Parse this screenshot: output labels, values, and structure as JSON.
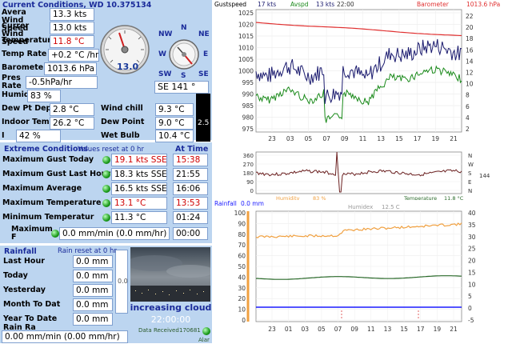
{
  "current": {
    "title": "Current Conditions, WD 10.375134",
    "rows": [
      {
        "label": "Avera Wind Speed",
        "value": "13.3 kts"
      },
      {
        "label": "Currer Wind Speed",
        "value": "13.0 kts"
      },
      {
        "label": "Temperature",
        "value": "11.8 °C"
      },
      {
        "label": "Temp Rate",
        "value": "+0.2 °C /hr"
      },
      {
        "label": "Barometer",
        "value": "1013.6 hPa"
      },
      {
        "label": "Pres Rate",
        "value": "-0.5hPa/hr"
      },
      {
        "label": "Humidit",
        "value": "83 %"
      },
      {
        "label": "Dew Pt Depr.",
        "value": "2.8 °C"
      },
      {
        "label": "Indoor Temp.",
        "value": "26.2 °C"
      },
      {
        "label": "I",
        "value": "42 %"
      }
    ],
    "dial_value": "13.0",
    "compass_labels": [
      "NW",
      "N",
      "NE",
      "W",
      "E",
      "SW",
      "S",
      "SE"
    ],
    "direction": "SE  141 °",
    "wind_chill_label": "Wind chill",
    "wind_chill": "9.3 °C",
    "dew_point_label": "Dew Point",
    "dew_point": "9.0 °C",
    "wet_bulb_label": "Wet Bulb",
    "wet_bulb": "10.4 °C",
    "side_value": "2.5"
  },
  "extreme": {
    "title": "Extreme Conditions",
    "subtitle": "Values reset at 0 hr",
    "at_time": "At Time",
    "rows": [
      {
        "label": "Maximum Gust Today",
        "value": "19.1 kts SSE",
        "time": "15:38",
        "red": true
      },
      {
        "label": "Maximum Gust Last Hour",
        "value": "18.3 kts SSE",
        "time": "21:55",
        "red": false
      },
      {
        "label": "Maximum Average",
        "value": "16.5 kts SSE",
        "time": "16:06",
        "red": false
      },
      {
        "label": "Maximum Temperature",
        "value": "13.1 °C",
        "time": "13:53",
        "red": true
      },
      {
        "label": "Minimum Temperatur",
        "value": "11.3 °C",
        "time": "01:24",
        "red": false
      },
      {
        "label": "Maximum F",
        "value": "0.0 mm/min (0.0 mm/hr)",
        "time": "00:00",
        "red": false
      }
    ]
  },
  "rain": {
    "title": "Rainfall",
    "subtitle": "Rain reset at 0 hr",
    "rows": [
      {
        "label": "Last Hour",
        "value": "0.0 mm"
      },
      {
        "label": "Today",
        "value": "0.0 mm"
      },
      {
        "label": "Yesterday",
        "value": "0.0 mm"
      },
      {
        "label": "Month To Dat",
        "value": "0.0 mm"
      },
      {
        "label": "Year To Date",
        "value": "0.0 mm"
      }
    ],
    "rate_label": "Rain Ra",
    "rate_value": "0.00 mm/min (0.00 mm/hr)",
    "gauge_value": "0.0"
  },
  "webcam": {
    "caption": "increasing cloud",
    "time": "22:00:00",
    "data_received_label": "Data Received",
    "data_received_value": "170681",
    "alarm_label": "Alar"
  },
  "top_chart": {
    "gust_label": "Gustspeed",
    "gust_value": "17 kts",
    "avspd_label": "Avspd",
    "avspd_value": "13 kts",
    "time": "22:00",
    "baro_label": "Barometer",
    "baro_value": "1013.6 hPa",
    "left_ticks": [
      "1025",
      "1020",
      "1015",
      "1010",
      "1005",
      "1000",
      "995",
      "990",
      "985",
      "980",
      "975"
    ],
    "right_ticks": [
      "22",
      "20",
      "18",
      "16",
      "14",
      "12",
      "10",
      "8",
      "6",
      "4",
      "2"
    ],
    "x_ticks": [
      "23",
      "03",
      "05",
      "07",
      "09",
      "11",
      "13",
      "15",
      "17",
      "19",
      "21"
    ]
  },
  "dir_chart": {
    "left_ticks": [
      "360",
      "270",
      "180",
      "90",
      "0"
    ],
    "right_ticks": [
      "N",
      "W",
      "S",
      "E",
      "N"
    ],
    "current": "144",
    "humidity_label": "Humidity",
    "humidity_value": "83 %",
    "temp_label": "Temperature",
    "temp_value": "11.8 °C"
  },
  "bottom_chart": {
    "rainfall_label": "Rainfall",
    "rainfall_value": "0.0 mm",
    "humidex_label": "Humidex",
    "humidex_value": "12.5 C",
    "left_ticks": [
      "100",
      "90",
      "80",
      "70",
      "60",
      "50",
      "40",
      "30",
      "20",
      "10",
      "0"
    ],
    "right_ticks": [
      "40",
      "35",
      "30",
      "25",
      "20",
      "15",
      "10",
      "5",
      "0",
      "-5"
    ],
    "x_ticks": [
      "23",
      "01",
      "03",
      "05",
      "07",
      "09",
      "11",
      "13",
      "15",
      "17",
      "19",
      "21"
    ]
  },
  "colors": {
    "panel_bg": "#bcd5f0",
    "title": "#1a2b9a",
    "gust": "#1a1a6e",
    "avspd": "#1a8a1a",
    "barometer": "#e03030",
    "direction": "#6b2020",
    "humidity": "#f0a040",
    "temperature": "#2a6a2a",
    "rain": "#1a1aff"
  }
}
